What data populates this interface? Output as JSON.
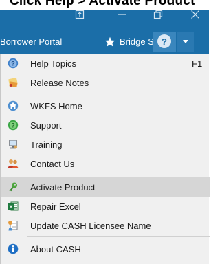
{
  "caption": "Click Help > Activate Product",
  "ribbon": {
    "borrower_portal": "Borrower Portal",
    "bridge_status": "Bridge Status",
    "help_glyph": "?"
  },
  "menu": {
    "items": [
      {
        "label": "Help Topics",
        "shortcut": "F1",
        "icon": "help-icon"
      },
      {
        "label": "Release Notes",
        "icon": "notes-icon"
      },
      {
        "label": "WKFS Home",
        "icon": "home-icon"
      },
      {
        "label": "Support",
        "icon": "support-icon"
      },
      {
        "label": "Training",
        "icon": "training-icon"
      },
      {
        "label": "Contact Us",
        "icon": "contact-icon"
      },
      {
        "label": "Activate Product",
        "icon": "key-icon",
        "highlighted": true
      },
      {
        "label": "Repair Excel",
        "icon": "excel-icon"
      },
      {
        "label": "Update CASH Licensee Name",
        "icon": "update-icon"
      },
      {
        "label": "About CASH",
        "icon": "info-icon"
      }
    ]
  },
  "colors": {
    "titlebar": "#1b6ea8",
    "menu_bg": "#f0f0f0",
    "highlight": "#d6d6d6"
  }
}
